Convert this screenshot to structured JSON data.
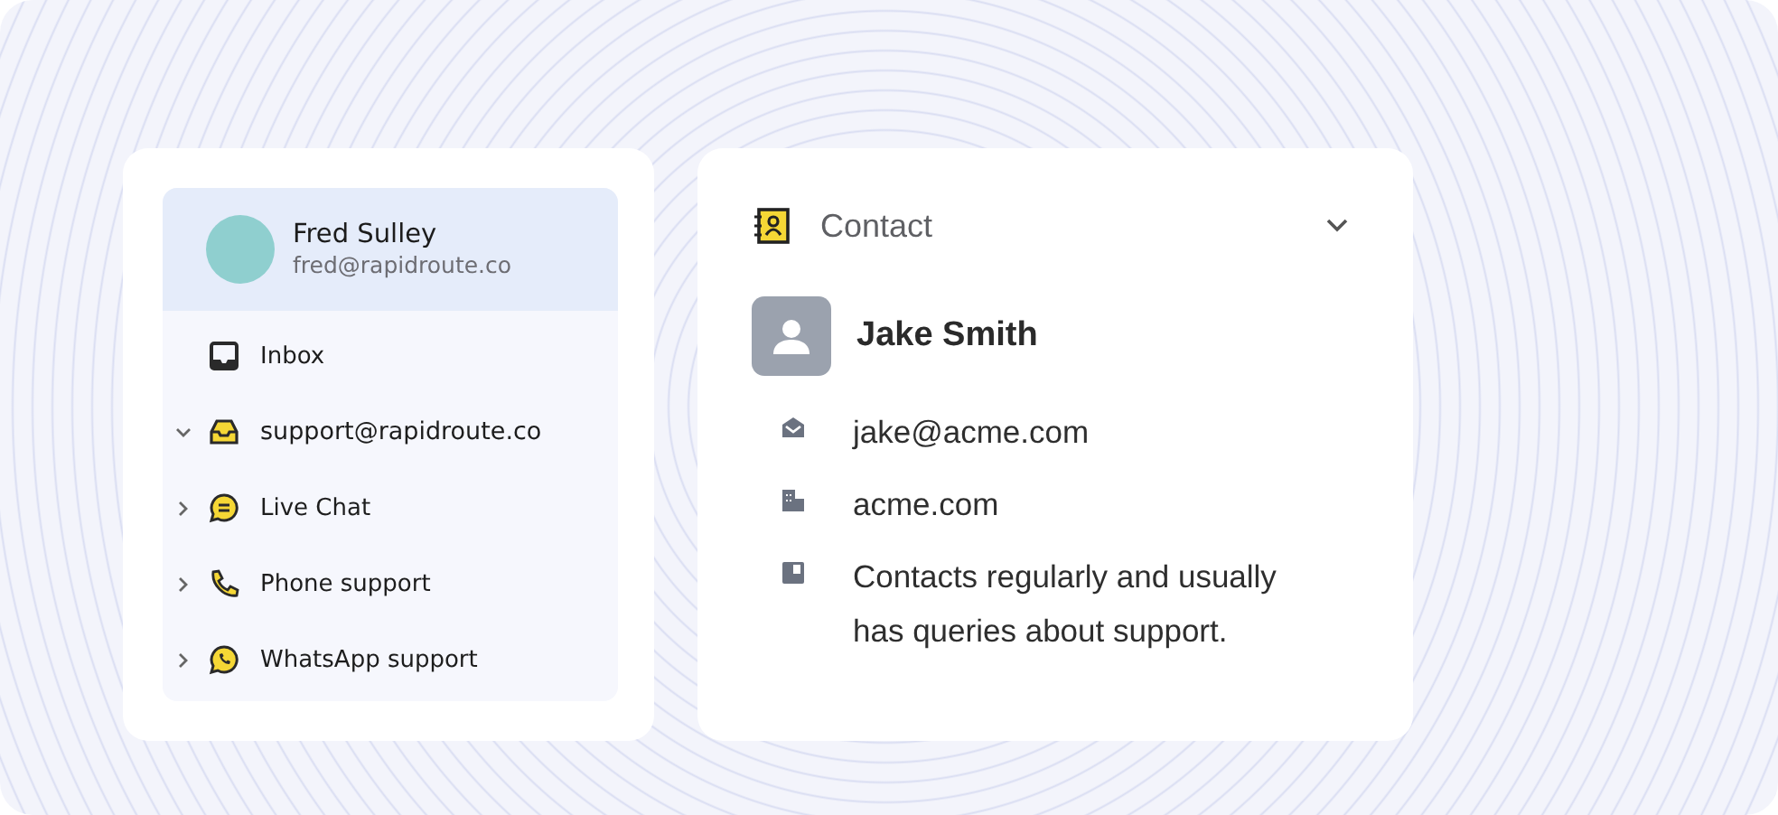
{
  "account": {
    "name": "Fred Sulley",
    "email": "fred@rapidroute.co"
  },
  "sidebar": {
    "items": [
      {
        "label": "Inbox",
        "kind": "inbox",
        "expandable": false
      },
      {
        "label": "support@rapidroute.co",
        "kind": "mailbox",
        "expandable": true,
        "expanded": true
      },
      {
        "label": "Live Chat",
        "kind": "chat",
        "expandable": true,
        "expanded": false
      },
      {
        "label": "Phone support",
        "kind": "phone",
        "expandable": true,
        "expanded": false
      },
      {
        "label": "WhatsApp support",
        "kind": "whatsapp",
        "expandable": true,
        "expanded": false
      }
    ]
  },
  "contact_panel": {
    "title": "Contact",
    "expanded": true,
    "name": "Jake Smith",
    "details": [
      {
        "kind": "email",
        "text": "jake@acme.com"
      },
      {
        "kind": "company",
        "text": "acme.com"
      },
      {
        "kind": "note",
        "text": "Contacts regularly and usually has queries about support."
      }
    ]
  }
}
